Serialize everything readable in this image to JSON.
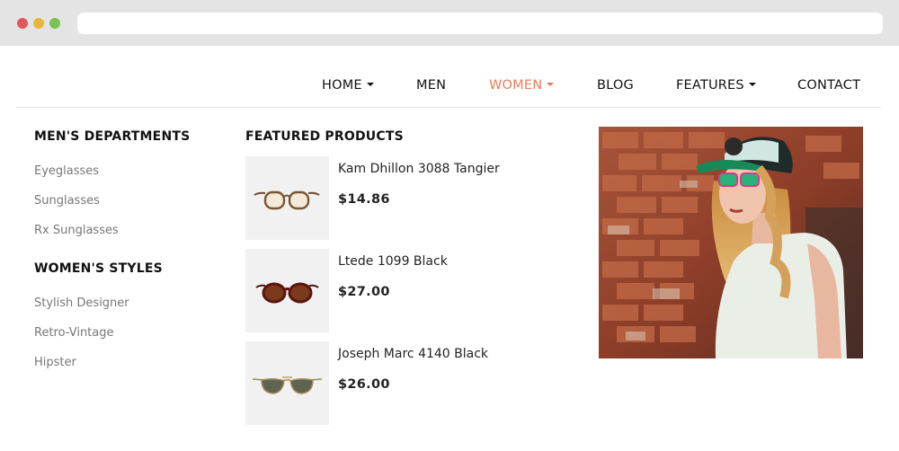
{
  "nav": {
    "items": [
      {
        "label": "HOME",
        "dropdown": true,
        "active": false
      },
      {
        "label": "MEN",
        "dropdown": false,
        "active": false
      },
      {
        "label": "WOMEN",
        "dropdown": true,
        "active": true
      },
      {
        "label": "BLOG",
        "dropdown": false,
        "active": false
      },
      {
        "label": "FEATURES",
        "dropdown": true,
        "active": false
      },
      {
        "label": "CONTACT",
        "dropdown": false,
        "active": false
      }
    ]
  },
  "mega_menu": {
    "mens_departments": {
      "heading": "MEN'S DEPARTMENTS",
      "links": [
        "Eyeglasses",
        "Sunglasses",
        "Rx Sunglasses"
      ]
    },
    "womens_styles": {
      "heading": "WOMEN'S STYLES",
      "links": [
        "Stylish Designer",
        "Retro-Vintage",
        "Hipster"
      ]
    },
    "featured": {
      "heading": "FEATURED PRODUCTS",
      "products": [
        {
          "name": "Kam Dhillon 3088 Tangier",
          "price": "$14.86",
          "icon": "eyeglasses-icon"
        },
        {
          "name": "Ltede 1099 Black",
          "price": "$27.00",
          "icon": "round-sunglasses-icon"
        },
        {
          "name": "Joseph Marc 4140 Black",
          "price": "$26.00",
          "icon": "aviator-sunglasses-icon"
        }
      ]
    }
  },
  "colors": {
    "active_nav": "#ec7a5a",
    "dot_red": "#e0595a",
    "dot_yellow": "#e8b739",
    "dot_green": "#7dc150"
  }
}
